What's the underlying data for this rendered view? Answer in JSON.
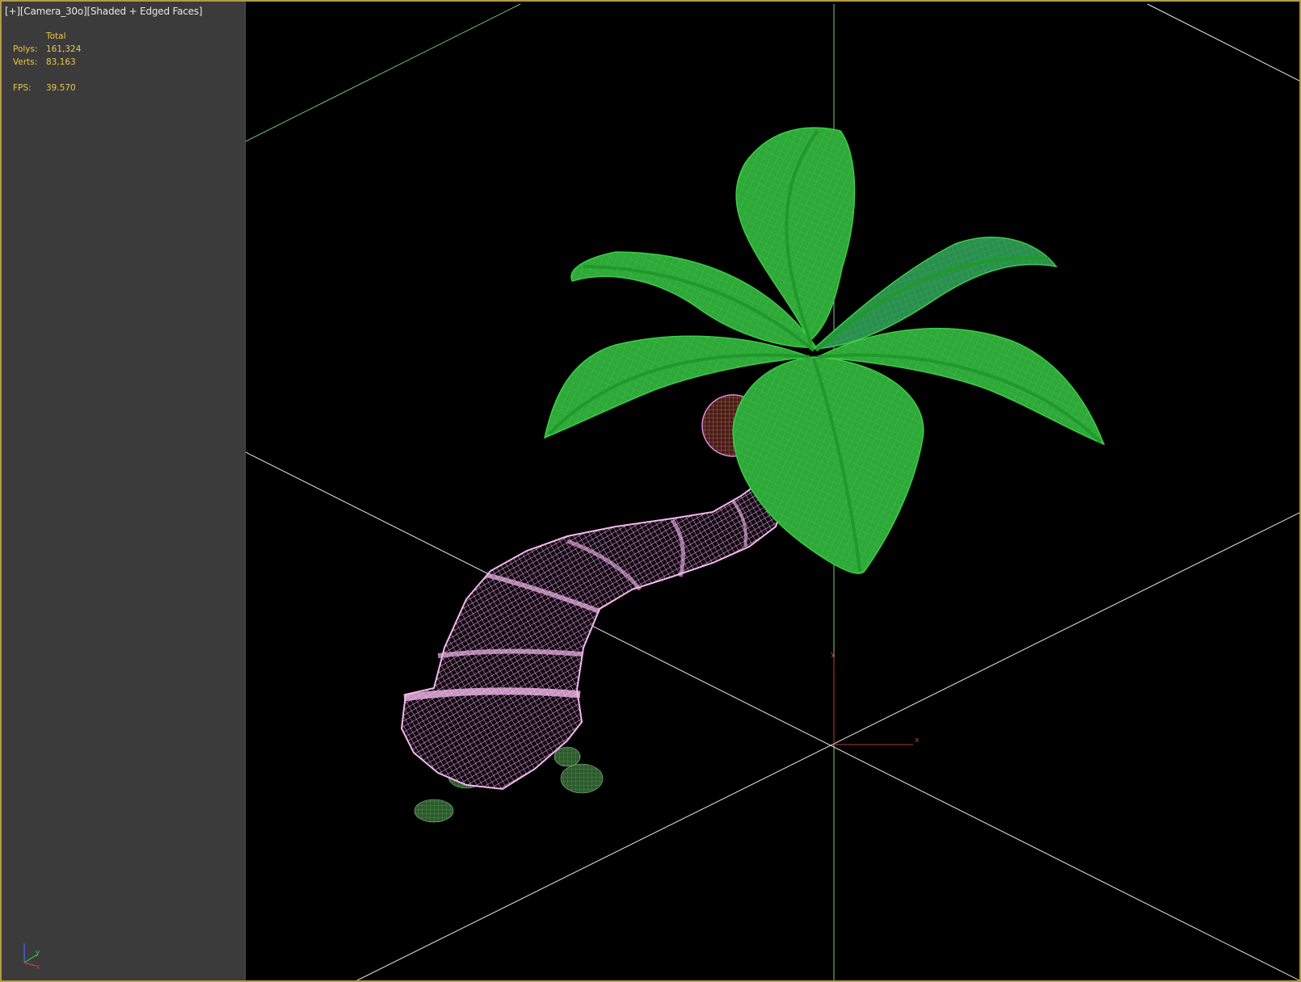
{
  "viewport": {
    "label_plus": "[+]",
    "label_camera": "[Camera_30o]",
    "label_mode": "[Shaded + Edged Faces]"
  },
  "stats": {
    "header": "Total",
    "polys_label": "Polys:",
    "polys_value": "161,324",
    "verts_label": "Verts:",
    "verts_value": "83,163",
    "fps_label": "FPS:",
    "fps_value": "39.570"
  },
  "gizmo": {
    "x": "x",
    "y": "y"
  },
  "mini_axis": {
    "y": "y",
    "x": "x"
  },
  "colors": {
    "frame": "#b39a45",
    "panel": "#3b3b3b",
    "stat_text": "#e8c84a",
    "leaf": "#2fb236",
    "trunk": "#f2b8ec",
    "grid": "#e8e8e8",
    "grid_green": "#7fcc7f"
  }
}
